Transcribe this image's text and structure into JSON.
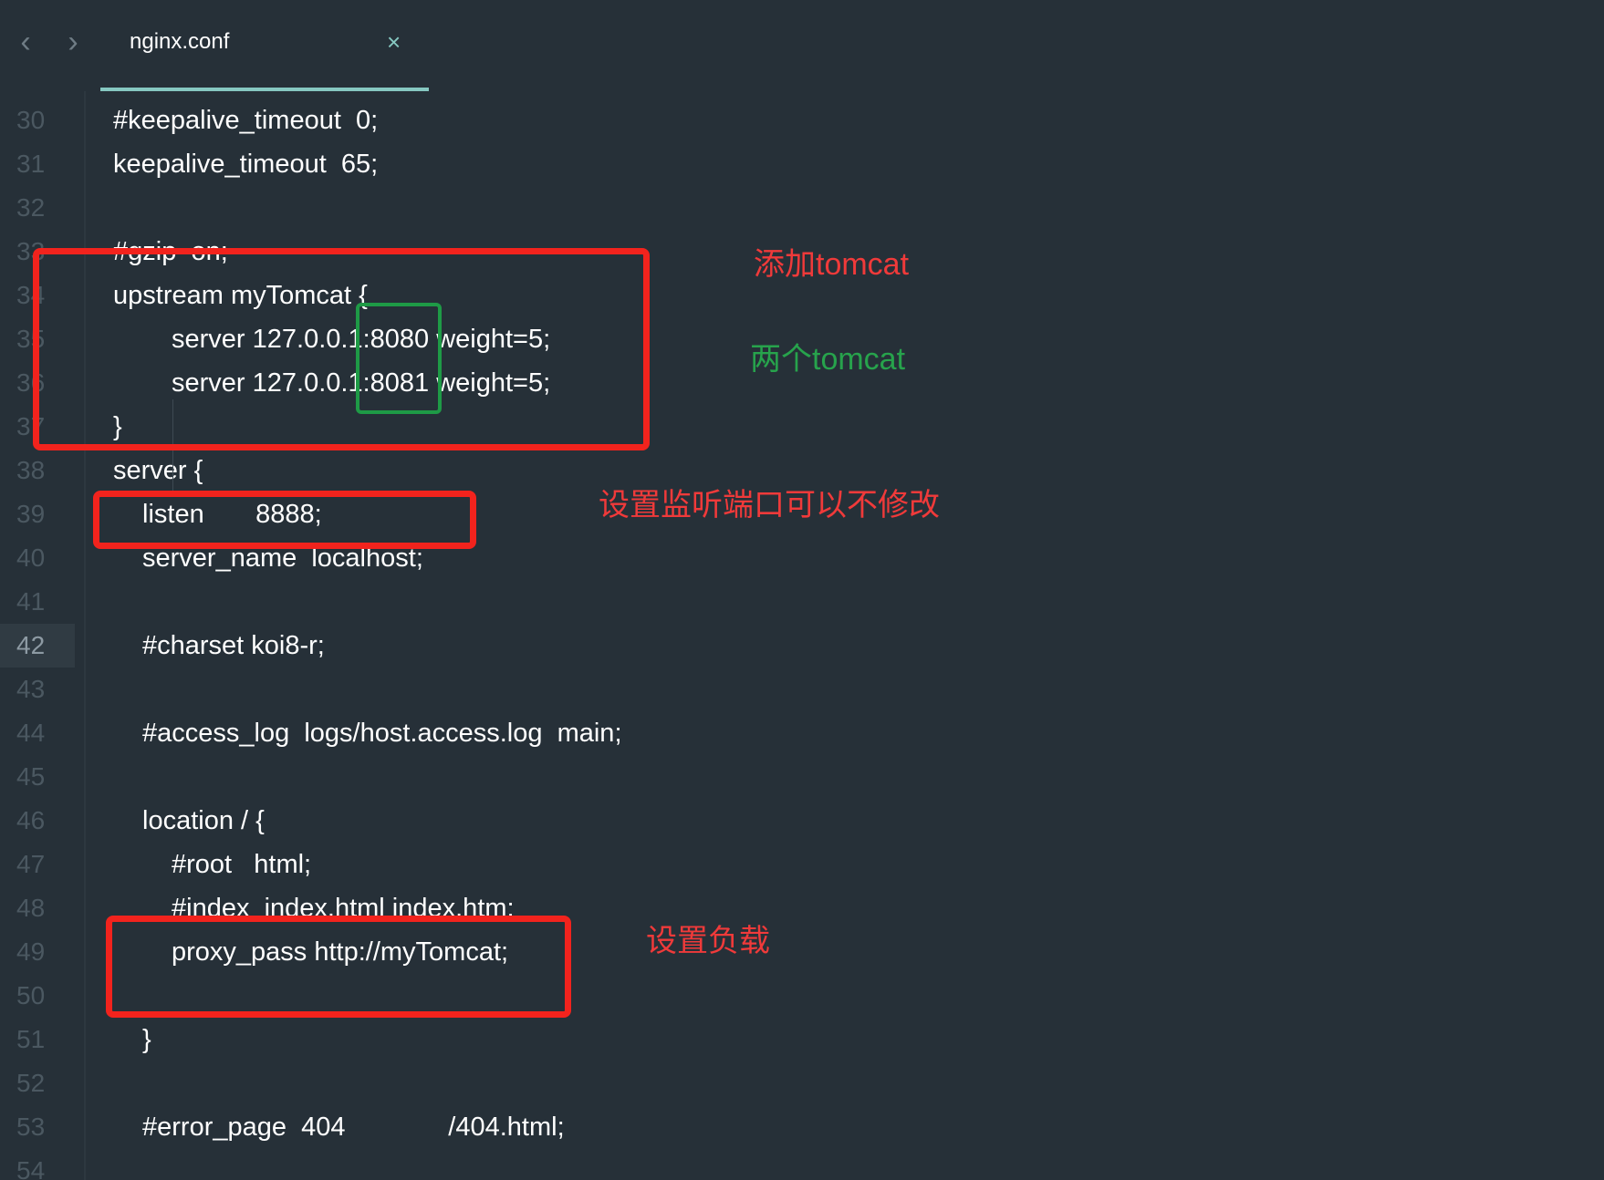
{
  "tabbar": {
    "back_glyph": "‹",
    "forward_glyph": "›",
    "tab_title": "nginx.conf",
    "close_glyph": "×"
  },
  "editor": {
    "active_line": "42",
    "lines": [
      {
        "num": "30",
        "text": "#keepalive_timeout  0;",
        "indent": 0
      },
      {
        "num": "31",
        "text": "keepalive_timeout  65;",
        "indent": 0
      },
      {
        "num": "32",
        "text": "",
        "indent": 0
      },
      {
        "num": "33",
        "text": "#gzip  on;",
        "indent": 0
      },
      {
        "num": "34",
        "text": "upstream myTomcat {",
        "indent": 0
      },
      {
        "num": "35",
        "text": "server 127.0.0.1:8080 weight=5;",
        "indent": 2
      },
      {
        "num": "36",
        "text": "server 127.0.0.1:8081 weight=5;",
        "indent": 2
      },
      {
        "num": "37",
        "text": "}",
        "indent": 0
      },
      {
        "num": "38",
        "text": "server {",
        "indent": 0
      },
      {
        "num": "39",
        "text": "listen       8888;",
        "indent": 1
      },
      {
        "num": "40",
        "text": "server_name  localhost;",
        "indent": 1
      },
      {
        "num": "41",
        "text": "",
        "indent": 0
      },
      {
        "num": "42",
        "text": "#charset koi8-r;",
        "indent": 1
      },
      {
        "num": "43",
        "text": "",
        "indent": 0
      },
      {
        "num": "44",
        "text": "#access_log  logs/host.access.log  main;",
        "indent": 1
      },
      {
        "num": "45",
        "text": "",
        "indent": 0
      },
      {
        "num": "46",
        "text": "location / {",
        "indent": 1
      },
      {
        "num": "47",
        "text": "#root   html;",
        "indent": 2
      },
      {
        "num": "48",
        "text": "#index  index.html index.htm;",
        "indent": 2
      },
      {
        "num": "49",
        "text": "proxy_pass http://myTomcat;",
        "indent": 2
      },
      {
        "num": "50",
        "text": "",
        "indent": 0
      },
      {
        "num": "51",
        "text": "}",
        "indent": 1
      },
      {
        "num": "52",
        "text": "",
        "indent": 0
      },
      {
        "num": "53",
        "text": "#error_page  404              /404.html;",
        "indent": 1
      },
      {
        "num": "54",
        "text": "",
        "indent": 0
      }
    ]
  },
  "annotations": {
    "add_tomcat": "添加tomcat",
    "two_tomcat": "两个tomcat",
    "listen_port": "设置监听端口可以不修改",
    "set_load": "设置负载"
  },
  "colors": {
    "background": "#263038",
    "annotation_red": "#f2231d",
    "annotation_green": "#1e9a46",
    "tab_accent": "#86c8c1"
  }
}
